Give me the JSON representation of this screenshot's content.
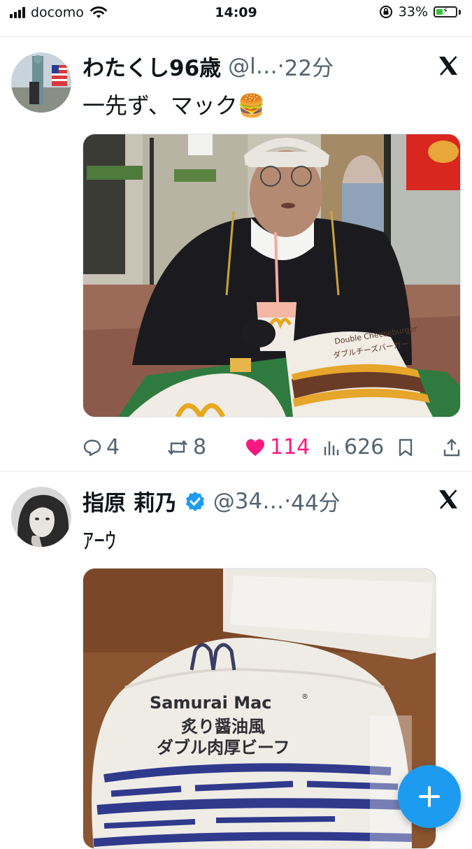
{
  "status_bar": {
    "carrier": "docomo",
    "time": "14:09",
    "battery": "33%",
    "battery_level": 0.33,
    "icons": [
      "signal-icon",
      "wifi-icon",
      "orientation-lock-icon",
      "battery-charging-icon"
    ]
  },
  "tweets": [
    {
      "name": "わたくし96歳",
      "handle": "@l…",
      "dot": "·",
      "time": "22分",
      "text": "一先ず、マック🍔",
      "actions": {
        "replies": "4",
        "retweets": "8",
        "likes": "114",
        "views": "626"
      },
      "liked": true,
      "media_text": {
        "burger_wrap": "Double Cheeseburger",
        "burger_wrap_jp": "ダブルチーズバーガー"
      }
    },
    {
      "name": "指原 莉乃",
      "verified": true,
      "handle": "@34…",
      "dot": "·",
      "time": "44分",
      "text": "ｱｰｳ",
      "media_text": {
        "brand": "Samurai Mac",
        "reg": "®",
        "line1": "炙り醤油風",
        "line2": "ダブル肉厚ビーフ"
      }
    }
  ],
  "colors": {
    "like": "#f91880",
    "accent": "#1d9bf0",
    "muted": "#536471",
    "battery": "#37c23f"
  }
}
